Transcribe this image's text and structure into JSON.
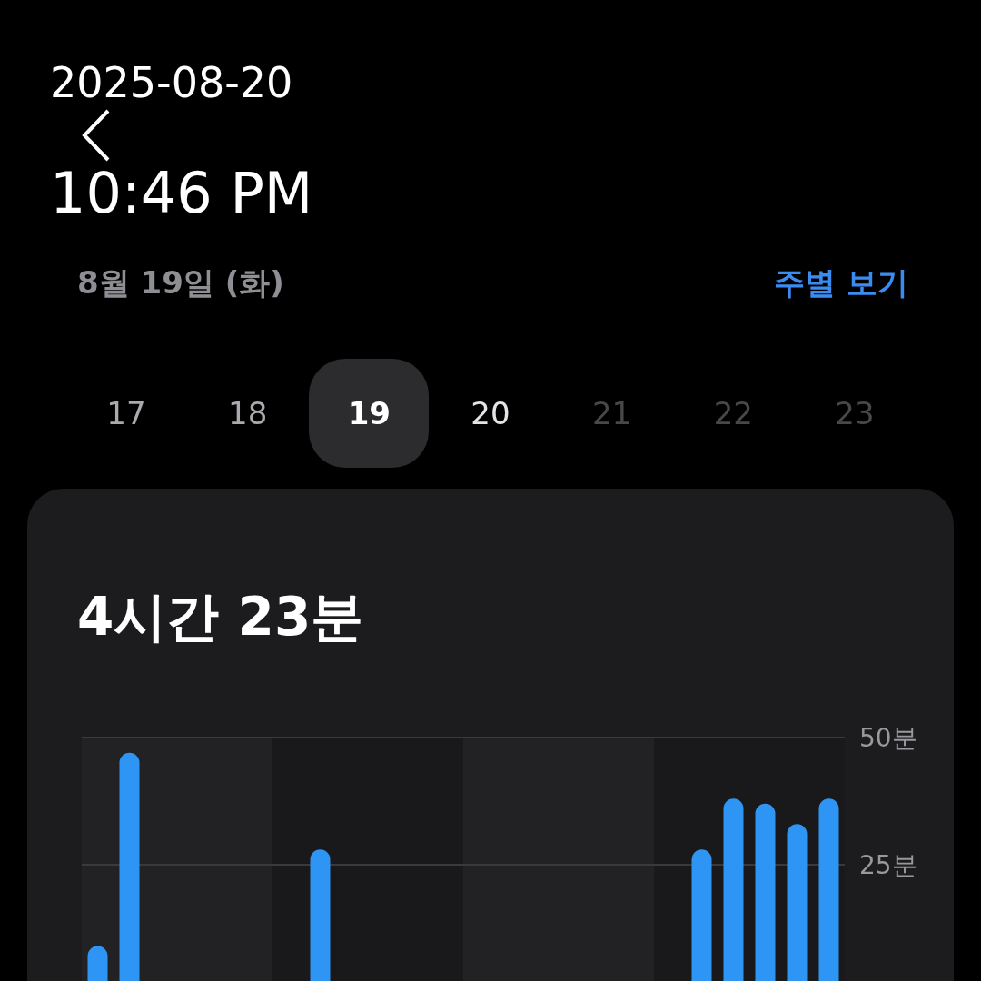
{
  "timestamp": {
    "date": "2025-08-20",
    "time": "10:46 PM"
  },
  "header": {
    "date": "8월 19일 (화)",
    "week_link": "주별 보기"
  },
  "days": [
    {
      "label": "17",
      "selected": false,
      "disabled": false,
      "today": false
    },
    {
      "label": "18",
      "selected": false,
      "disabled": false,
      "today": false
    },
    {
      "label": "19",
      "selected": true,
      "disabled": false,
      "today": false
    },
    {
      "label": "20",
      "selected": false,
      "disabled": false,
      "today": true
    },
    {
      "label": "21",
      "selected": false,
      "disabled": true,
      "today": false
    },
    {
      "label": "22",
      "selected": false,
      "disabled": true,
      "today": false
    },
    {
      "label": "23",
      "selected": false,
      "disabled": true,
      "today": false
    }
  ],
  "summary": {
    "total": "4시간 23분",
    "chart_data": {
      "type": "bar",
      "ylim": [
        0,
        50
      ],
      "yticks": [
        {
          "value": 50,
          "label": "50분"
        },
        {
          "value": 25,
          "label": "25분"
        }
      ],
      "values": [
        9,
        47,
        0,
        0,
        0,
        0,
        0,
        28,
        0,
        0,
        0,
        0,
        0,
        0,
        0,
        0,
        0,
        0,
        0,
        28,
        38,
        37,
        33,
        38
      ]
    }
  }
}
